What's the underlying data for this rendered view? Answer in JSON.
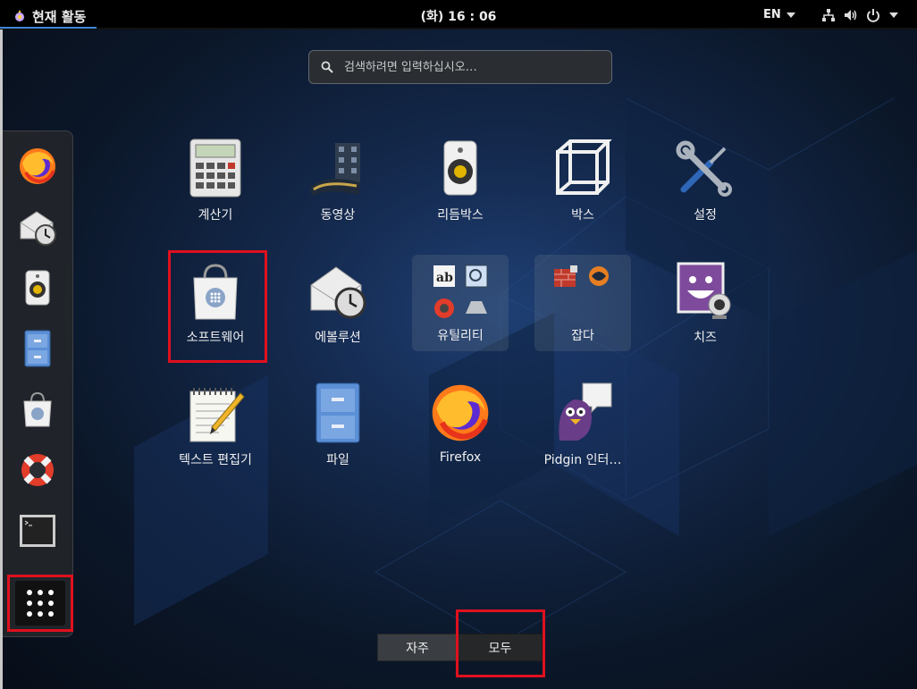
{
  "topbar": {
    "activities_label": "현재 활동",
    "clock": "(화) 16 : 06",
    "language": "EN"
  },
  "search": {
    "placeholder": "검색하려면 입력하십시오…"
  },
  "dash": {
    "items": [
      {
        "name": "firefox",
        "icon": "firefox-icon"
      },
      {
        "name": "evolution",
        "icon": "mail-clock-icon"
      },
      {
        "name": "rhythmbox",
        "icon": "speaker-icon"
      },
      {
        "name": "files",
        "icon": "file-cabinet-icon"
      },
      {
        "name": "software",
        "icon": "shopping-bag-icon"
      },
      {
        "name": "help",
        "icon": "lifebuoy-icon"
      },
      {
        "name": "terminal",
        "icon": "terminal-icon"
      }
    ],
    "show_apps": "grid-icon"
  },
  "apps": [
    {
      "label": "계산기",
      "icon": "calculator-icon"
    },
    {
      "label": "동영상",
      "icon": "film-reel-icon"
    },
    {
      "label": "리듬박스",
      "icon": "speaker-icon"
    },
    {
      "label": "박스",
      "icon": "cube-icon"
    },
    {
      "label": "설정",
      "icon": "tools-icon"
    },
    {
      "label": "소프트웨어",
      "icon": "shopping-bag-icon"
    },
    {
      "label": "에볼루션",
      "icon": "mail-clock-icon"
    },
    {
      "label": "유틸리티",
      "icon": "folder-icon"
    },
    {
      "label": "잡다",
      "icon": "folder-icon"
    },
    {
      "label": "치즈",
      "icon": "webcam-icon"
    },
    {
      "label": "텍스트 편집기",
      "icon": "notepad-icon"
    },
    {
      "label": "파일",
      "icon": "file-cabinet-icon"
    },
    {
      "label": "Firefox",
      "icon": "firefox-icon"
    },
    {
      "label": "Pidgin 인터…",
      "icon": "pidgin-icon"
    }
  ],
  "view_toggle": {
    "frequent": "자주",
    "all": "모두"
  },
  "colors": {
    "highlight": "#e0101e",
    "accent": "#3d86d6"
  }
}
